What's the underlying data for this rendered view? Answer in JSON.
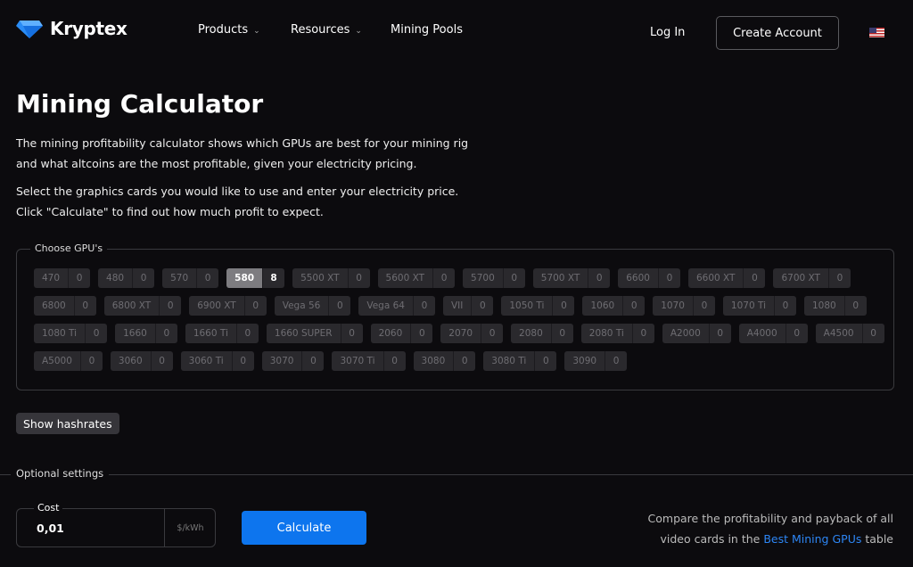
{
  "nav": {
    "brand": "Kryptex",
    "links": [
      {
        "label": "Products",
        "dropdown": true
      },
      {
        "label": "Resources",
        "dropdown": true
      },
      {
        "label": "Mining Pools",
        "dropdown": false
      }
    ],
    "login": "Log In",
    "create_account": "Create Account",
    "language_flag": "us-flag-icon"
  },
  "page": {
    "title": "Mining Calculator",
    "intro_1": "The mining profitability calculator shows which GPUs are best for your mining rig",
    "intro_2": "and what altcoins are the most profitable, given your electricity pricing.",
    "intro_3": "Select the graphics cards you would like to use and enter your electricity price.",
    "intro_4": "Click \"Calculate\" to find out how much profit to expect."
  },
  "gpus": {
    "legend": "Choose GPU's",
    "rows": [
      [
        {
          "name": "470",
          "count": "0"
        },
        {
          "name": "480",
          "count": "0"
        },
        {
          "name": "570",
          "count": "0"
        },
        {
          "name": "580",
          "count": "8",
          "selected": true
        },
        {
          "name": "5500 XT",
          "count": "0"
        },
        {
          "name": "5600 XT",
          "count": "0"
        },
        {
          "name": "5700",
          "count": "0"
        },
        {
          "name": "5700 XT",
          "count": "0"
        },
        {
          "name": "6600",
          "count": "0"
        },
        {
          "name": "6600 XT",
          "count": "0"
        },
        {
          "name": "6700 XT",
          "count": "0"
        }
      ],
      [
        {
          "name": "6800",
          "count": "0"
        },
        {
          "name": "6800 XT",
          "count": "0"
        },
        {
          "name": "6900 XT",
          "count": "0"
        },
        {
          "name": "Vega 56",
          "count": "0"
        },
        {
          "name": "Vega 64",
          "count": "0"
        },
        {
          "name": "VII",
          "count": "0"
        },
        {
          "name": "1050 Ti",
          "count": "0"
        },
        {
          "name": "1060",
          "count": "0"
        },
        {
          "name": "1070",
          "count": "0"
        },
        {
          "name": "1070 Ti",
          "count": "0"
        },
        {
          "name": "1080",
          "count": "0"
        }
      ],
      [
        {
          "name": "1080 Ti",
          "count": "0"
        },
        {
          "name": "1660",
          "count": "0"
        },
        {
          "name": "1660 Ti",
          "count": "0"
        },
        {
          "name": "1660 SUPER",
          "count": "0"
        },
        {
          "name": "2060",
          "count": "0"
        },
        {
          "name": "2070",
          "count": "0"
        },
        {
          "name": "2080",
          "count": "0"
        },
        {
          "name": "2080 Ti",
          "count": "0"
        },
        {
          "name": "A2000",
          "count": "0"
        },
        {
          "name": "A4000",
          "count": "0"
        },
        {
          "name": "A4500",
          "count": "0"
        }
      ],
      [
        {
          "name": "A5000",
          "count": "0"
        },
        {
          "name": "3060",
          "count": "0"
        },
        {
          "name": "3060 Ti",
          "count": "0"
        },
        {
          "name": "3070",
          "count": "0"
        },
        {
          "name": "3070 Ti",
          "count": "0"
        },
        {
          "name": "3080",
          "count": "0"
        },
        {
          "name": "3080 Ti",
          "count": "0"
        },
        {
          "name": "3090",
          "count": "0"
        }
      ]
    ]
  },
  "show_hashrates": "Show hashrates",
  "optional": {
    "label": "Optional settings",
    "cost_label": "Cost",
    "cost_value": "0,01",
    "unit": "$/kWh",
    "calculate": "Calculate"
  },
  "compare": {
    "line1": "Compare the profitability and payback of all",
    "line2_pre": "video cards in the ",
    "link": "Best Mining GPUs",
    "line2_post": " table"
  },
  "colors": {
    "accent": "#0d75ee",
    "link": "#2d86f5",
    "background": "#0c0b0e"
  }
}
